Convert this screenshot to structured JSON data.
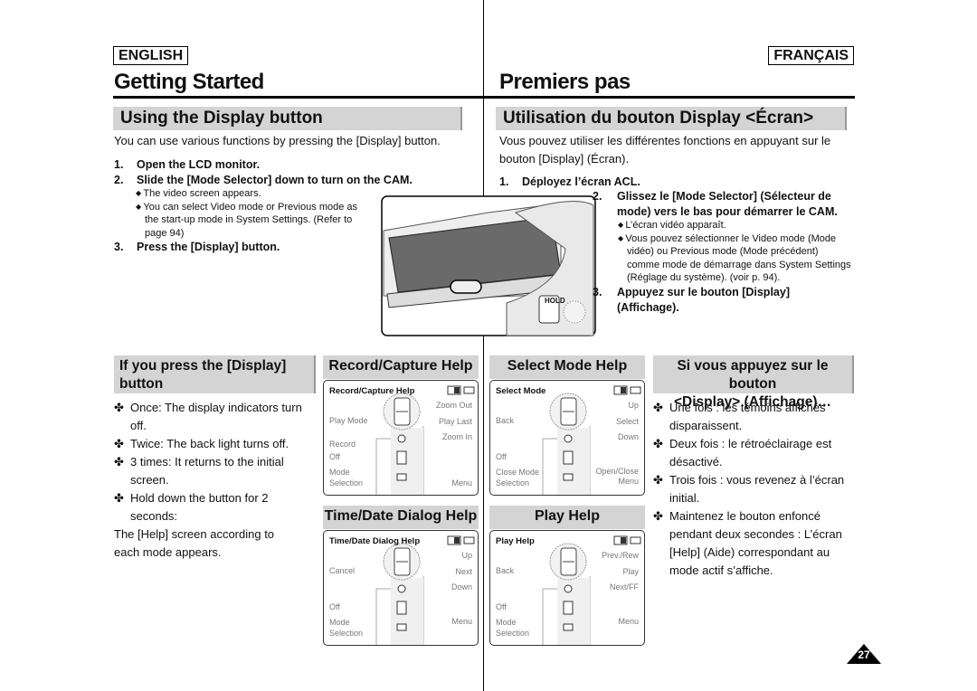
{
  "english": {
    "lang": "ENGLISH",
    "title": "Getting Started",
    "section": "Using the Display button",
    "intro": "You can use various functions by pressing the [Display] button.",
    "steps": [
      {
        "n": "1.",
        "text": "Open the LCD monitor."
      },
      {
        "n": "2.",
        "text": "Slide the [Mode Selector] down to turn on the CAM."
      },
      {
        "n": "3.",
        "text": "Press the [Display] button."
      }
    ],
    "bullets": [
      "The video screen appears.",
      "You can select Video mode or Previous mode as",
      "the start-up mode in System Settings. (Refer to",
      "page 94)"
    ],
    "sub_heading_1": "If you press the [Display]",
    "sub_heading_2": "button",
    "press_list": [
      {
        "c": "✤",
        "lines": [
          "Once: The display indicators turn",
          "off."
        ]
      },
      {
        "c": "✤",
        "lines": [
          "Twice: The back light turns off."
        ]
      },
      {
        "c": "✤",
        "lines": [
          "3 times: It returns to the initial",
          "screen."
        ]
      },
      {
        "c": "✤",
        "lines": [
          "Hold down the button for 2",
          "seconds:",
          "The [Help] screen according to",
          "each mode appears."
        ]
      }
    ]
  },
  "french": {
    "lang": "FRANÇAIS",
    "title": "Premiers pas",
    "section": "Utilisation du bouton Display <Écran>",
    "intro_lines": [
      "Vous pouvez utiliser les différentes fonctions en appuyant sur le",
      "bouton [Display] (Écran)."
    ],
    "step1": {
      "n": "1.",
      "text": "Déployez l’écran ACL."
    },
    "step2": {
      "n": "2.",
      "lines": [
        "Glissez le [Mode Selector] (Sélecteur de",
        "mode) vers le bas pour démarrer le CAM."
      ]
    },
    "bullets": [
      "L’écran vidéo apparaît.",
      "Vous pouvez sélectionner le Video mode (Mode",
      "vidéo) ou Previous mode (Mode précédent)",
      "comme mode de démarrage dans System Settings",
      "(Réglage du système). (voir p. 94)."
    ],
    "step3": {
      "n": "3.",
      "lines": [
        "Appuyez sur le bouton [Display]",
        "(Affichage)."
      ]
    },
    "sub_heading_1": "Si vous appuyez sur le bouton",
    "sub_heading_2": "<Display> (Affichage)…",
    "press_list": [
      {
        "c": "✤",
        "lines": [
          "Une fois : les témoins affichés",
          "disparaissent."
        ]
      },
      {
        "c": "✤",
        "lines": [
          "Deux fois : le rétroéclairage est",
          "désactivé."
        ]
      },
      {
        "c": "✤",
        "lines": [
          "Trois fois : vous revenez à l’écran",
          "initial."
        ]
      },
      {
        "c": "✤",
        "lines": [
          "Maintenez le bouton enfoncé",
          "pendant deux secondes : L’écran",
          "[Help] (Aide) correspondant au",
          "mode actif s’affiche."
        ]
      }
    ]
  },
  "camera_image": {
    "hold_label": "HOLD"
  },
  "help_panels": [
    {
      "heading": "Record/Capture Help",
      "title": "Record/Capture Help",
      "left": [
        {
          "slot": "mid",
          "text": "Play Mode"
        },
        {
          "slot": "record",
          "text": "Record"
        },
        {
          "slot": "off",
          "text": "Off"
        },
        {
          "slot": "mode1",
          "text": "Mode"
        },
        {
          "slot": "mode2",
          "text": "Selection"
        }
      ],
      "right": [
        {
          "slot": "top",
          "text": "Zoom Out"
        },
        {
          "slot": "mid",
          "text": "Play Last"
        },
        {
          "slot": "low",
          "text": "Zoom In"
        },
        {
          "slot": "menu",
          "text": "Menu"
        }
      ]
    },
    {
      "heading": "Select Mode Help",
      "title": "Select Mode",
      "left": [
        {
          "slot": "mid",
          "text": "Back"
        },
        {
          "slot": "off",
          "text": "Off"
        },
        {
          "slot": "mode1",
          "text": "Close Mode"
        },
        {
          "slot": "mode2",
          "text": "Selection"
        }
      ],
      "right": [
        {
          "slot": "top",
          "text": "Up"
        },
        {
          "slot": "mid",
          "text": "Select"
        },
        {
          "slot": "low",
          "text": "Down"
        },
        {
          "slot": "menu1",
          "text": "Open/Close"
        },
        {
          "slot": "menu2",
          "text": "Menu"
        }
      ]
    },
    {
      "heading": "Time/Date Dialog Help",
      "title": "Time/Date Dialog Help",
      "left": [
        {
          "slot": "mid",
          "text": "Cancel"
        },
        {
          "slot": "off",
          "text": "Off"
        },
        {
          "slot": "mode1",
          "text": "Mode"
        },
        {
          "slot": "mode2",
          "text": "Selection"
        }
      ],
      "right": [
        {
          "slot": "top",
          "text": "Up"
        },
        {
          "slot": "mid",
          "text": "Next"
        },
        {
          "slot": "low",
          "text": "Down"
        },
        {
          "slot": "menu1",
          "text": "Menu"
        }
      ]
    },
    {
      "heading": "Play Help",
      "title": "Play Help",
      "left": [
        {
          "slot": "mid",
          "text": "Back"
        },
        {
          "slot": "off",
          "text": "Off"
        },
        {
          "slot": "mode1",
          "text": "Mode"
        },
        {
          "slot": "mode2",
          "text": "Selection"
        }
      ],
      "right": [
        {
          "slot": "top",
          "text": "Prev./Rew"
        },
        {
          "slot": "mid",
          "text": "Play"
        },
        {
          "slot": "low",
          "text": "Next/FF"
        },
        {
          "slot": "menu1",
          "text": "Menu"
        }
      ]
    }
  ],
  "page_number": "27",
  "colors": {
    "section_bar": "#d4d4d4",
    "label_gray": "#777777"
  }
}
